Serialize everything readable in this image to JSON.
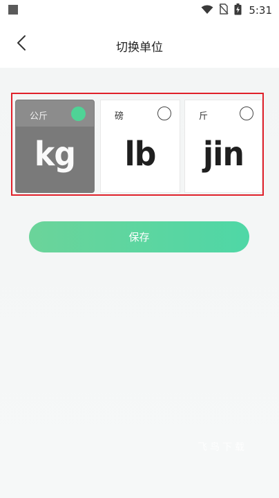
{
  "status_bar": {
    "time": "5:31"
  },
  "header": {
    "title": "切换单位"
  },
  "units": [
    {
      "name": "公斤",
      "symbol": "kg",
      "selected": true
    },
    {
      "name": "磅",
      "symbol": "lb",
      "selected": false
    },
    {
      "name": "斤",
      "symbol": "jin",
      "selected": false
    }
  ],
  "actions": {
    "save_label": "保存"
  },
  "watermark": "飞鸟下载",
  "colors": {
    "accent": "#4fd396",
    "selected_card": "#7a7a7a",
    "highlight_border": "#e0202a"
  }
}
